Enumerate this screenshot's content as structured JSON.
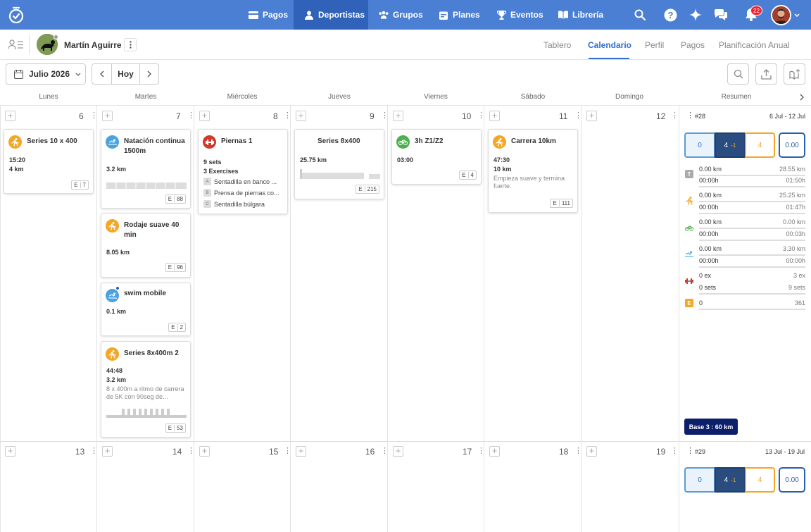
{
  "nav": {
    "items": [
      {
        "label": "Pagos"
      },
      {
        "label": "Deportistas"
      },
      {
        "label": "Grupos"
      },
      {
        "label": "Planes"
      },
      {
        "label": "Eventos"
      },
      {
        "label": "Librería"
      }
    ],
    "notification_count": "22",
    "accent": "#4a7fd4"
  },
  "athlete": {
    "name": "Martín Aguirre",
    "tabs": [
      {
        "label": "Tablero"
      },
      {
        "label": "Calendario"
      },
      {
        "label": "Perfil"
      },
      {
        "label": "Pagos"
      },
      {
        "label": "Planificación Anual"
      }
    ]
  },
  "toolbar": {
    "month": "Julio 2026",
    "today": "Hoy"
  },
  "days": [
    "Lunes",
    "Martes",
    "Miércoles",
    "Jueves",
    "Viernes",
    "Sábado",
    "Domingo",
    "Resumen"
  ],
  "week1": {
    "dates": [
      "6",
      "7",
      "8",
      "9",
      "10",
      "11",
      "12"
    ],
    "summary": {
      "number": "#28",
      "range": "6 Jul - 12 Jul",
      "boxes": [
        "0",
        "4",
        "-1",
        "4",
        "0.00"
      ],
      "rows": [
        {
          "icon": "T",
          "a": "0.00 km",
          "ar": "28.55 km",
          "b": "00:00h",
          "br": "01:50h"
        },
        {
          "icon": "run-icon",
          "a": "0.00 km",
          "ar": "25.25 km",
          "b": "00:00h",
          "br": "01:47h"
        },
        {
          "icon": "bike-icon",
          "a": "0.00 km",
          "ar": "0.00 km",
          "b": "00:00h",
          "br": "00:03h"
        },
        {
          "icon": "swim-icon",
          "a": "0.00 km",
          "ar": "3.30 km",
          "b": "00:00h",
          "br": "00:00h"
        },
        {
          "icon": "strength-icon",
          "a": "0 ex",
          "ar": "3 ex",
          "b": "0 sets",
          "br": "9 sets"
        },
        {
          "icon": "E",
          "a": "0",
          "ar": "361"
        }
      ],
      "base": "Base 3 : 60 km"
    }
  },
  "week2": {
    "dates": [
      "13",
      "14",
      "15",
      "16",
      "17",
      "18",
      "19"
    ],
    "summary": {
      "number": "#29",
      "range": "13 Jul - 19 Jul",
      "boxes": [
        "0",
        "4",
        "-1",
        "4",
        "0.00"
      ]
    }
  },
  "cards": {
    "mon": {
      "title": "Series 10 x 400",
      "l1": "15:20",
      "l2": "4 km",
      "e": "7"
    },
    "tue1": {
      "title": "Natación continua 1500m",
      "l1": "3.2 km",
      "e": "88"
    },
    "tue2": {
      "title": "Rodaje suave 40 min",
      "l1": "8.05 km",
      "e": "96"
    },
    "tue3": {
      "title": "swim mobile",
      "l1": "0.1 km",
      "e": "2"
    },
    "tue4": {
      "title": "Series 8x400m 2",
      "l1": "44:48",
      "l2": "3.2 km",
      "note": "8 x 400m a ritmo de carrera de 5K con 90seg de...",
      "e": "53"
    },
    "wed": {
      "title": "Piernas 1",
      "l1": "9 sets",
      "l2": "3 Exercises",
      "ex": [
        {
          "k": "A",
          "n": "Sentadilla en banco ..."
        },
        {
          "k": "B",
          "n": "Prensa de piernas co..."
        },
        {
          "k": "C",
          "n": "Sentadilla búlgara"
        }
      ]
    },
    "thu": {
      "title": "Series 8x400",
      "l1": "25.75 km",
      "e": "215"
    },
    "fri": {
      "title": "3h Z1/Z2",
      "l1": "03:00",
      "e": "4"
    },
    "sat": {
      "title": "Carrera 10km",
      "l1": "47:30",
      "l2": "10 km",
      "note": "Empieza suave y termina fuerte.",
      "e": "111"
    }
  },
  "colors": {
    "run": "#f5a623",
    "swim": "#4aa3df",
    "bike": "#4caf50",
    "strength": "#d0392b",
    "E": "#f5a623"
  }
}
